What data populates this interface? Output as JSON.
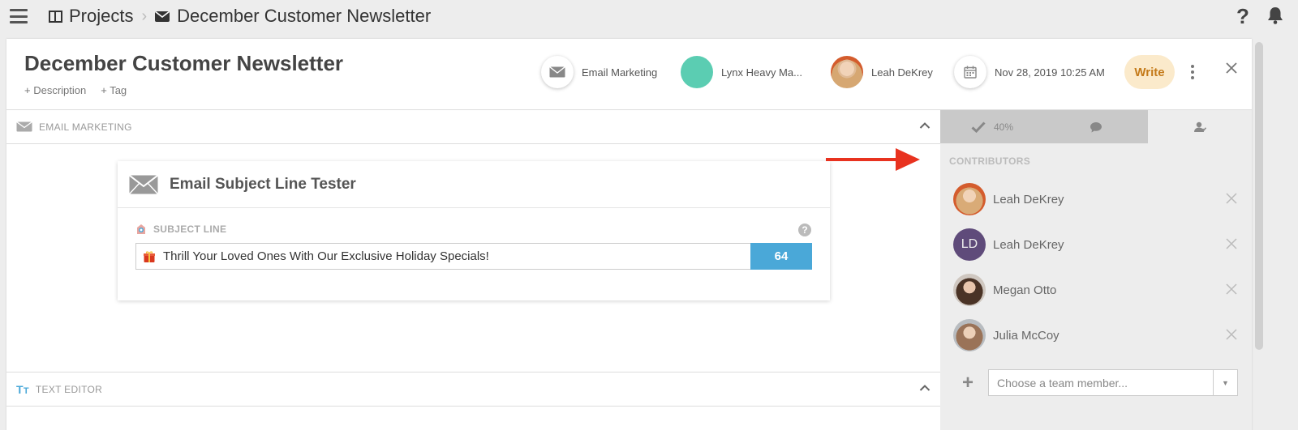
{
  "breadcrumb": {
    "projects": "Projects",
    "current": "December Customer Newsletter"
  },
  "header": {
    "title": "December Customer Newsletter",
    "add_description": "+ Description",
    "add_tag": "+ Tag",
    "channel": "Email Marketing",
    "brand": "Lynx Heavy Ma...",
    "owner": "Leah DeKrey",
    "date": "Nov 28, 2019 10:25 AM",
    "write_label": "Write"
  },
  "sections": {
    "email_marketing": "EMAIL MARKETING",
    "text_editor": "TEXT EDITOR"
  },
  "tester": {
    "title": "Email Subject Line Tester",
    "subject_label": "SUBJECT LINE",
    "subject_value": "Thrill Your Loved Ones With Our Exclusive Holiday Specials!",
    "score": "64",
    "help": "?"
  },
  "sidebar": {
    "progress_tab": "40%",
    "contributors_label": "CONTRIBUTORS",
    "contributors": [
      {
        "name": "Leah DeKrey"
      },
      {
        "name": "Leah DeKrey",
        "initials": "LD"
      },
      {
        "name": "Megan Otto"
      },
      {
        "name": "Julia McCoy"
      }
    ],
    "choose_placeholder": "Choose a team member..."
  },
  "colors": {
    "accent_blue": "#4aa8d8",
    "write_bg": "#fbeacb",
    "write_text": "#c47a19",
    "brand_teal": "#5bcdb2",
    "annotation_red": "#e8321f"
  }
}
